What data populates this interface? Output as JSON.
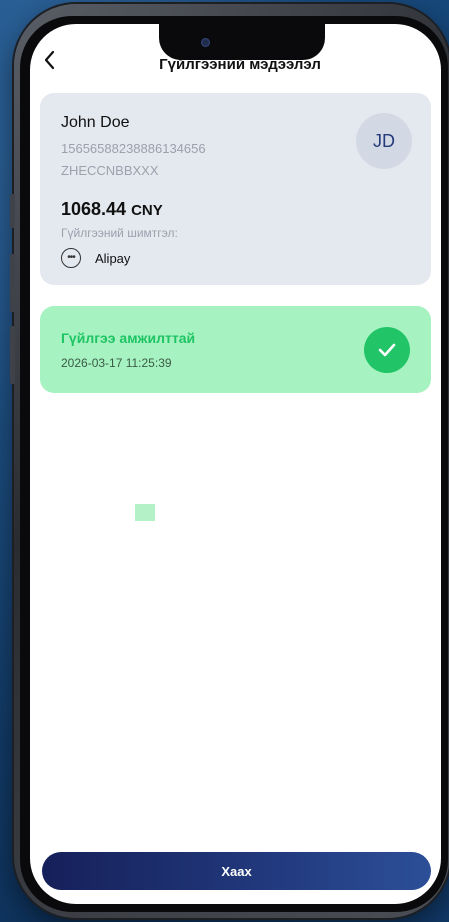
{
  "header": {
    "back_icon": "chevron-left-icon",
    "title": "Гүйлгээний мэдээлэл"
  },
  "recipient": {
    "name": "John Doe",
    "account_number": "15656588238886134656",
    "swift_code": "ZHECCNBBXXX",
    "avatar_initials": "JD"
  },
  "transaction": {
    "amount": "1068.44",
    "currency": "CNY",
    "fee_label": "Гүйлгээний шимтгэл:",
    "payment_icon": "chat-dots-icon",
    "payment_method": "Alipay"
  },
  "status": {
    "title": "Гүйлгээ амжилттай",
    "timestamp": "2026-03-17 11:25:39",
    "icon": "check-circle-icon"
  },
  "footer": {
    "close_label": "Хаах"
  },
  "colors": {
    "success_green": "#21c466",
    "success_bg": "#a6f3c1",
    "button_navy": "#1a2a6a",
    "card_bg": "#e4e8ef"
  }
}
